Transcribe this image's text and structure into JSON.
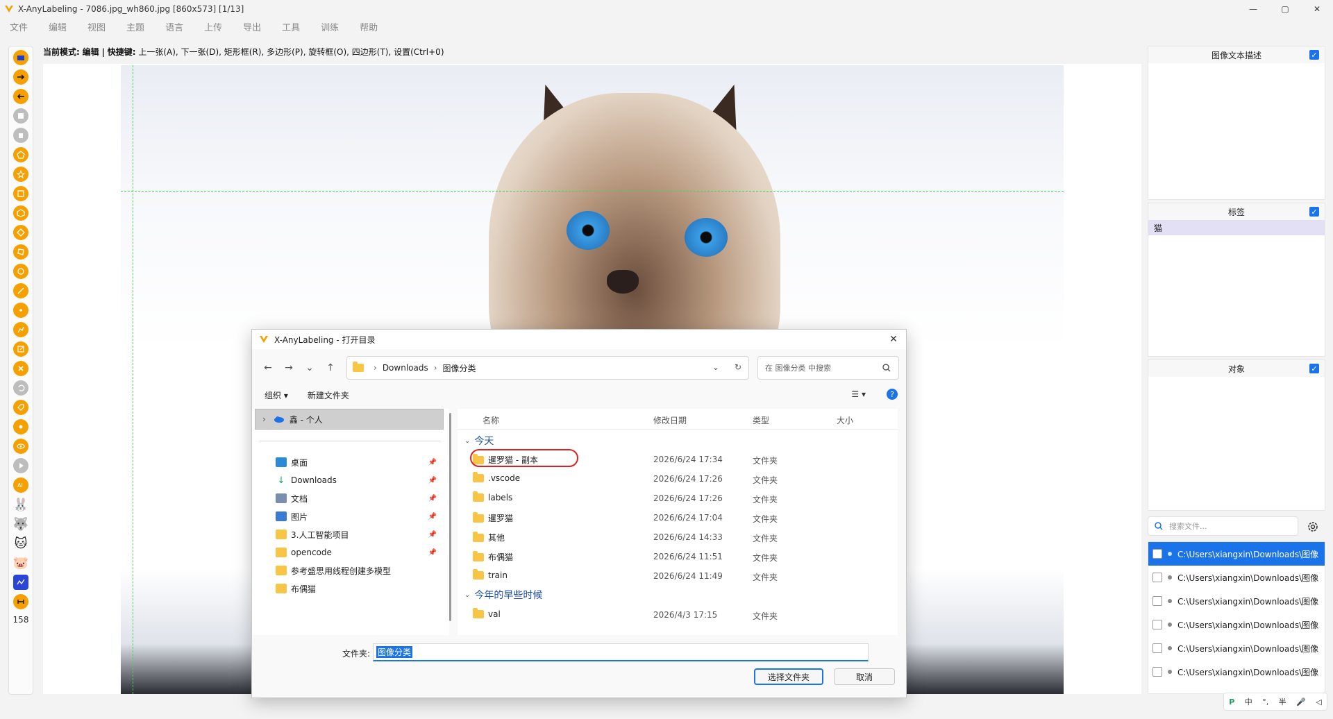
{
  "window": {
    "title": "X-AnyLabeling - 7086.jpg_wh860.jpg [860x573] [1/13]",
    "controls": [
      "—",
      "▢",
      "✕"
    ]
  },
  "menu": [
    "文件",
    "编辑",
    "视图",
    "主题",
    "语言",
    "上传",
    "导出",
    "工具",
    "训练",
    "帮助"
  ],
  "mode_line": {
    "prefix": "当前模式:",
    "mode": "编辑",
    "sep": "|",
    "shortcut_label": "快捷键:",
    "shortcuts": "上一张(A), 下一张(D), 矩形框(R), 多边形(P), 旋转框(O), 四边形(T), 设置(Ctrl+0)"
  },
  "toolbar": {
    "count": "158"
  },
  "panels": {
    "description": {
      "title": "图像文本描述"
    },
    "labels": {
      "title": "标签",
      "items": [
        "猫"
      ]
    },
    "objects": {
      "title": "对象"
    }
  },
  "file_search": {
    "placeholder": "搜索文件..."
  },
  "files": [
    {
      "path": "C:\\Users\\xiangxin\\Downloads\\图像",
      "active": true
    },
    {
      "path": "C:\\Users\\xiangxin\\Downloads\\图像",
      "active": false
    },
    {
      "path": "C:\\Users\\xiangxin\\Downloads\\图像",
      "active": false
    },
    {
      "path": "C:\\Users\\xiangxin\\Downloads\\图像",
      "active": false
    },
    {
      "path": "C:\\Users\\xiangxin\\Downloads\\图像",
      "active": false
    },
    {
      "path": "C:\\Users\\xiangxin\\Downloads\\图像",
      "active": false
    }
  ],
  "ime": [
    "中",
    "°,",
    "半",
    "🎤",
    "◁"
  ],
  "dialog": {
    "title": "X-AnyLabeling - 打开目录",
    "address": {
      "crumb1": "Downloads",
      "crumb2": "图像分类"
    },
    "search_placeholder": "在 图像分类 中搜索",
    "toolbar": {
      "organize": "组织 ▾",
      "new_folder": "新建文件夹"
    },
    "nav_root": "鑫 - 个人",
    "nav_items": [
      {
        "label": "桌面",
        "color": "#2d8ad8",
        "pinned": true
      },
      {
        "label": "Downloads",
        "color": "#1b9e5a",
        "pinned": true
      },
      {
        "label": "文档",
        "color": "#7a8fb0",
        "pinned": true
      },
      {
        "label": "图片",
        "color": "#3a7bd5",
        "pinned": true
      },
      {
        "label": "3.人工智能项目",
        "color": "#f8c547",
        "pinned": true
      },
      {
        "label": "opencode",
        "color": "#f8c547",
        "pinned": true
      },
      {
        "label": "参考盛思用线程创建多模型",
        "color": "#f8c547",
        "pinned": false
      },
      {
        "label": "布偶猫",
        "color": "#f8c547",
        "pinned": false
      }
    ],
    "columns": {
      "name": "名称",
      "date": "修改日期",
      "type": "类型",
      "size": "大小"
    },
    "groups": {
      "today": "今天",
      "earlier": "今年的早些时候"
    },
    "files_today": [
      {
        "name": "暹罗猫 - 副本",
        "date": "2026/6/24 17:34",
        "type": "文件夹"
      },
      {
        "name": ".vscode",
        "date": "2026/6/24 17:26",
        "type": "文件夹"
      },
      {
        "name": "labels",
        "date": "2026/6/24 17:26",
        "type": "文件夹"
      },
      {
        "name": "暹罗猫",
        "date": "2026/6/24 17:04",
        "type": "文件夹"
      },
      {
        "name": "其他",
        "date": "2026/6/24 14:33",
        "type": "文件夹"
      },
      {
        "name": "布偶猫",
        "date": "2026/6/24 11:51",
        "type": "文件夹"
      },
      {
        "name": "train",
        "date": "2026/6/24 11:49",
        "type": "文件夹"
      }
    ],
    "files_earlier": [
      {
        "name": "val",
        "date": "2026/4/3 17:15",
        "type": "文件夹"
      }
    ],
    "folder_label": "文件夹:",
    "folder_value": "图像分类",
    "select_button": "选择文件夹",
    "cancel_button": "取消"
  },
  "colors": {
    "accent": "#1a73e8",
    "tool_orange": "#f5a000",
    "guide_green": "#4bd44b",
    "highlight_red": "#e02020"
  }
}
